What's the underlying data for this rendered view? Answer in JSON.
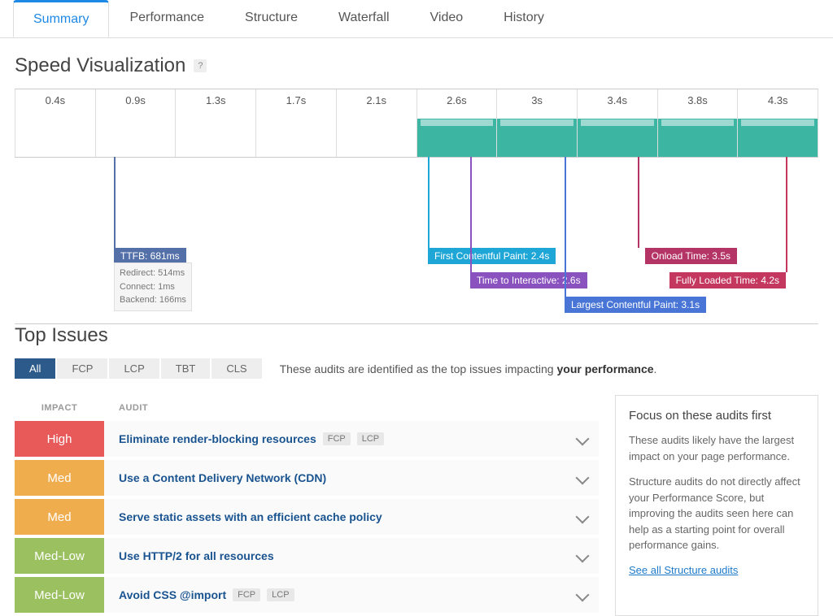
{
  "tabs": [
    "Summary",
    "Performance",
    "Structure",
    "Waterfall",
    "Video",
    "History"
  ],
  "activeTab": 0,
  "speedViz": {
    "title": "Speed Visualization",
    "times": [
      "0.4s",
      "0.9s",
      "1.3s",
      "1.7s",
      "2.1s",
      "2.6s",
      "3s",
      "3.4s",
      "3.8s",
      "4.3s"
    ],
    "loadedFrom": 5,
    "markers": {
      "ttfb": {
        "label": "TTFB: 681ms",
        "details": [
          "Redirect: 514ms",
          "Connect: 1ms",
          "Backend: 166ms"
        ]
      },
      "fcp": {
        "label": "First Contentful Paint: 2.4s"
      },
      "tti": {
        "label": "Time to Interactive: 2.6s"
      },
      "lcp": {
        "label": "Largest Contentful Paint: 3.1s"
      },
      "onload": {
        "label": "Onload Time: 3.5s"
      },
      "flt": {
        "label": "Fully Loaded Time: 4.2s"
      }
    }
  },
  "topIssues": {
    "title": "Top Issues",
    "filters": [
      "All",
      "FCP",
      "LCP",
      "TBT",
      "CLS"
    ],
    "activeFilter": 0,
    "desc_pre": "These audits are identified as the top issues impacting ",
    "desc_bold": "your performance",
    "desc_post": ".",
    "headers": {
      "impact": "IMPACT",
      "audit": "AUDIT"
    },
    "rows": [
      {
        "impact": "High",
        "impactClass": "impact-high",
        "title": "Eliminate render-blocking resources",
        "tags": [
          "FCP",
          "LCP"
        ]
      },
      {
        "impact": "Med",
        "impactClass": "impact-med",
        "title": "Use a Content Delivery Network (CDN)",
        "tags": []
      },
      {
        "impact": "Med",
        "impactClass": "impact-med",
        "title": "Serve static assets with an efficient cache policy",
        "tags": []
      },
      {
        "impact": "Med-Low",
        "impactClass": "impact-medlow",
        "title": "Use HTTP/2 for all resources",
        "tags": []
      },
      {
        "impact": "Med-Low",
        "impactClass": "impact-medlow",
        "title": "Avoid CSS @import",
        "tags": [
          "FCP",
          "LCP"
        ]
      }
    ]
  },
  "sidePanel": {
    "title": "Focus on these audits first",
    "p1": "These audits likely have the largest impact on your page performance.",
    "p2": "Structure audits do not directly affect your Performance Score, but improving the audits seen here can help as a starting point for overall performance gains.",
    "link": "See all Structure audits"
  }
}
